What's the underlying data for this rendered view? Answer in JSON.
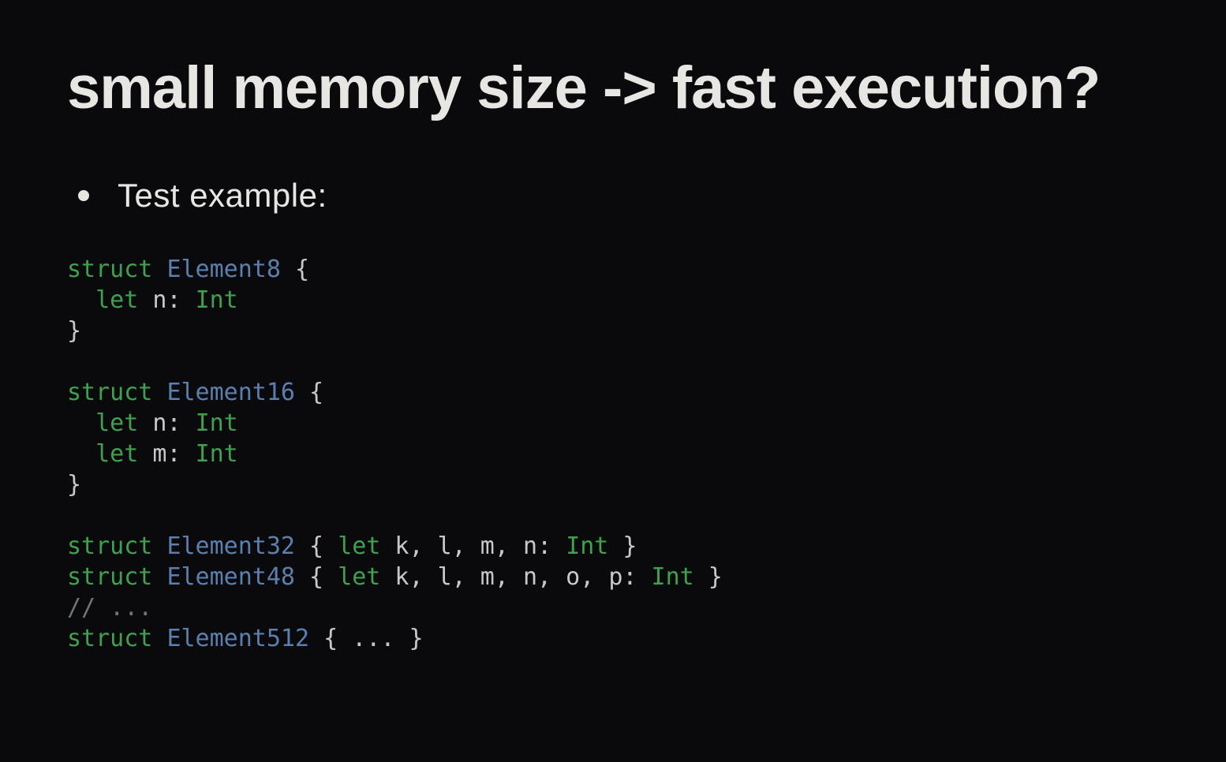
{
  "title": "small memory size -> fast execution?",
  "bullet": "Test example:",
  "code": {
    "line1_struct": "struct",
    "line1_name": "Element8",
    "line1_open": " {",
    "line2_let": "  let",
    "line2_var": " n",
    "line2_colon": ": ",
    "line2_type": "Int",
    "line3_close": "}",
    "blank1": "",
    "line4_struct": "struct",
    "line4_name": "Element16",
    "line4_open": " {",
    "line5_let": "  let",
    "line5_var": " n",
    "line5_colon": ": ",
    "line5_type": "Int",
    "line6_let": "  let",
    "line6_var": " m",
    "line6_colon": ": ",
    "line6_type": "Int",
    "line7_close": "}",
    "blank2": "",
    "line8_struct": "struct",
    "line8_name": "Element32",
    "line8_open": " { ",
    "line8_let": "let",
    "line8_vars": " k, l, m, n",
    "line8_colon": ": ",
    "line8_type": "Int",
    "line8_close": " }",
    "line9_struct": "struct",
    "line9_name": "Element48",
    "line9_open": " { ",
    "line9_let": "let",
    "line9_vars": " k, l, m, n, o, p",
    "line9_colon": ": ",
    "line9_type": "Int",
    "line9_close": " }",
    "line10_comment": "// ...",
    "line11_struct": "struct",
    "line11_name": "Element512",
    "line11_rest": " { ... }"
  }
}
